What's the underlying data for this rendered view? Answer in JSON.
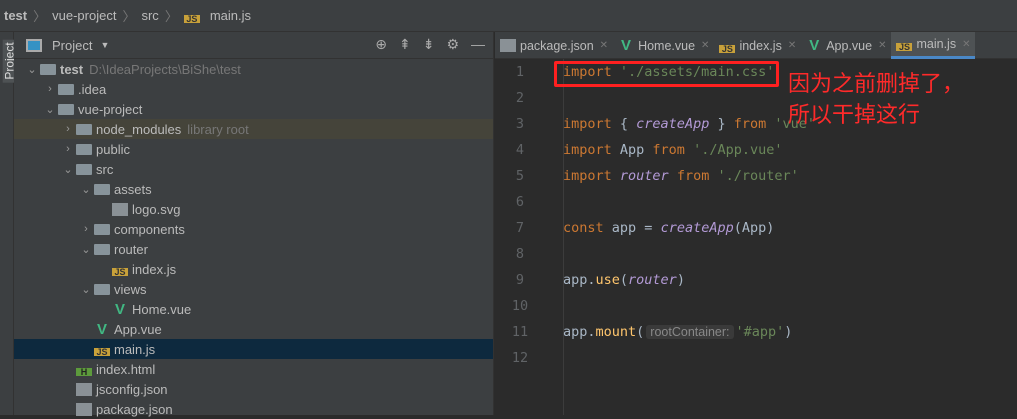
{
  "breadcrumb": [
    "test",
    "vue-project",
    "src",
    "main.js"
  ],
  "sidebar_label": "Project",
  "project_panel": {
    "title": "Project",
    "tools": [
      "locate-icon",
      "expand-all-icon",
      "collapse-all-icon",
      "gear-icon",
      "minimize-icon"
    ]
  },
  "tree": [
    {
      "label": "test",
      "hint": "D:\\IdeaProjects\\BiShe\\test",
      "depth": 0,
      "icon": "folder",
      "chev": "open",
      "bold": true
    },
    {
      "label": ".idea",
      "depth": 1,
      "icon": "folder",
      "chev": "closed"
    },
    {
      "label": "vue-project",
      "depth": 1,
      "icon": "folder",
      "chev": "open"
    },
    {
      "label": "node_modules",
      "hint": "library root",
      "depth": 2,
      "icon": "folder",
      "chev": "closed",
      "lib": true
    },
    {
      "label": "public",
      "depth": 2,
      "icon": "folder",
      "chev": "closed"
    },
    {
      "label": "src",
      "depth": 2,
      "icon": "folder",
      "chev": "open"
    },
    {
      "label": "assets",
      "depth": 3,
      "icon": "folder",
      "chev": "open"
    },
    {
      "label": "logo.svg",
      "depth": 4,
      "icon": "file"
    },
    {
      "label": "components",
      "depth": 3,
      "icon": "folder",
      "chev": "closed"
    },
    {
      "label": "router",
      "depth": 3,
      "icon": "folder",
      "chev": "open"
    },
    {
      "label": "index.js",
      "depth": 4,
      "icon": "js"
    },
    {
      "label": "views",
      "depth": 3,
      "icon": "folder",
      "chev": "open"
    },
    {
      "label": "Home.vue",
      "depth": 4,
      "icon": "vue"
    },
    {
      "label": "App.vue",
      "depth": 3,
      "icon": "vue"
    },
    {
      "label": "main.js",
      "depth": 3,
      "icon": "js",
      "selected": true
    },
    {
      "label": "index.html",
      "depth": 2,
      "icon": "html"
    },
    {
      "label": "jsconfig.json",
      "depth": 2,
      "icon": "file"
    },
    {
      "label": "package.json",
      "depth": 2,
      "icon": "file"
    }
  ],
  "tabs": [
    {
      "label": "package.json",
      "icon": "file"
    },
    {
      "label": "Home.vue",
      "icon": "vue"
    },
    {
      "label": "index.js",
      "icon": "js"
    },
    {
      "label": "App.vue",
      "icon": "vue"
    },
    {
      "label": "main.js",
      "icon": "js",
      "active": true
    }
  ],
  "code": [
    [
      [
        "kw",
        "import "
      ],
      [
        "str",
        "'./assets/main.css'"
      ]
    ],
    [],
    [
      [
        "kw",
        "import "
      ],
      [
        "p",
        "{ "
      ],
      [
        "fn",
        "createApp"
      ],
      [
        "p",
        " } "
      ],
      [
        "kw",
        "from "
      ],
      [
        "str",
        "'vue'"
      ]
    ],
    [
      [
        "kw",
        "import "
      ],
      [
        "p",
        "App "
      ],
      [
        "kw",
        "from "
      ],
      [
        "str",
        "'./App.vue'"
      ]
    ],
    [
      [
        "kw",
        "import "
      ],
      [
        "fn",
        "router"
      ],
      [
        "kw",
        " from "
      ],
      [
        "str",
        "'./router'"
      ]
    ],
    [],
    [
      [
        "kw",
        "const "
      ],
      [
        "p",
        "app = "
      ],
      [
        "fn",
        "createApp"
      ],
      [
        "p",
        "(App)"
      ]
    ],
    [],
    [
      [
        "p",
        "app."
      ],
      [
        "m",
        "use"
      ],
      [
        "p",
        "("
      ],
      [
        "fn",
        "router"
      ],
      [
        "p",
        ")"
      ]
    ],
    [],
    [
      [
        "p",
        "app."
      ],
      [
        "m",
        "mount"
      ],
      [
        "p",
        "("
      ],
      [
        "hint",
        "rootContainer:"
      ],
      [
        "str",
        "'#app'"
      ],
      [
        "p",
        ")"
      ]
    ],
    []
  ],
  "annotation": {
    "line1": "因为之前删掉了，",
    "line2": "所以干掉这行",
    "color": "#ff2020"
  }
}
